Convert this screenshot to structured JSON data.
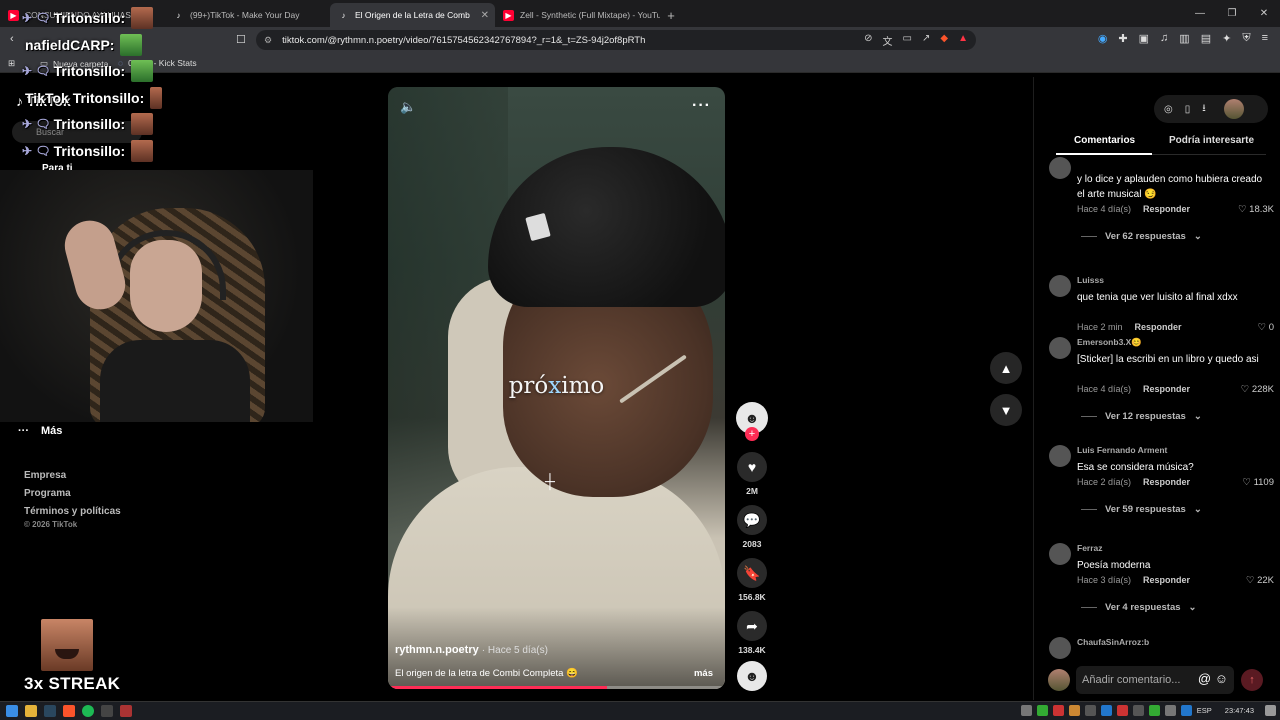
{
  "browser": {
    "tabs": [
      {
        "title": "CONSUMIENDO AYAHUASCA",
        "favicon": "youtube-icon",
        "color": "#ff0033"
      },
      {
        "title": "(99+)TikTok - Make Your Day",
        "favicon": "tiktok-icon",
        "color": "#ffffff"
      },
      {
        "title": "El Origen de la Letra de Comb",
        "favicon": "tiktok-icon",
        "color": "#ffffff"
      },
      {
        "title": "Zell - Synthetic (Full Mixtape) - YouTu",
        "favicon": "youtube-icon",
        "color": "#ff0033"
      }
    ],
    "url": "tiktok.com/@rythmn.n.poetry/video/7615754562342767894?_r=1&_t=ZS-94j2of8pRTh",
    "bookmarks": [
      {
        "label": "Nueva carpeta",
        "icon": "folder-icon"
      },
      {
        "label": "0Laco - Kick Stats",
        "icon": "kick-icon"
      }
    ]
  },
  "overlay": {
    "chat": [
      {
        "prefix": "✈ 🗨",
        "name": "Tritonsillo:",
        "emote": "face"
      },
      {
        "prefix": "",
        "name": "nafieldCARP:",
        "emote": "green"
      },
      {
        "prefix": "✈ 🗨",
        "name": "Tritonsillo:",
        "emote": "green"
      },
      {
        "prefix": "",
        "name": "TikTok Tritonsillo:",
        "emote": "face"
      },
      {
        "prefix": "✈ 🗨",
        "name": "Tritonsillo:",
        "emote": "face"
      },
      {
        "prefix": "✈ 🗨",
        "name": "Tritonsillo:",
        "emote": "face"
      }
    ],
    "streak": "3x STREAK"
  },
  "sidebar": {
    "logo": "TikTok",
    "search_placeholder": "Buscar",
    "for_you": "Para ti",
    "more": "Más",
    "links": [
      "Empresa",
      "Programa",
      "Términos y políticas"
    ],
    "copyright": "© 2026 TikTok"
  },
  "video": {
    "caption_pre": "pró",
    "caption_x": "x",
    "caption_post": "imo",
    "author": "rythmn.n.poetry",
    "posted": "· Hace 5 día(s)",
    "description": "El origen de la letra de Combi Completa 😄",
    "more_label": "más",
    "progress": 0.65,
    "accent": "#fe2c55"
  },
  "actions": {
    "likes": "2M",
    "comments": "2083",
    "saves": "156.8K",
    "shares": "138.4K"
  },
  "panel": {
    "tabs": [
      "Comentarios",
      "Podría interesarte"
    ],
    "comments": [
      {
        "user": "",
        "text": "y lo dice y aplauden como hubiera creado el arte musical 😏",
        "time": "Hace 4 día(s)",
        "likes": "18.3K",
        "replies": "Ver 62 respuestas"
      },
      {
        "user": "Luisss",
        "text": "que tenia que ver luisito al final xdxx",
        "time": "Hace 2 min",
        "likes": "0",
        "replies": ""
      },
      {
        "user": "Emersonb3.X😊",
        "text": "[Sticker] la escribi en un libro y quedo asi",
        "time": "Hace 4 día(s)",
        "likes": "228K",
        "replies": "Ver 12 respuestas"
      },
      {
        "user": "Luis Fernando Arment",
        "text": "Esa se considera música?",
        "time": "Hace 2 día(s)",
        "likes": "1109",
        "replies": "Ver 59 respuestas"
      },
      {
        "user": "Ferraz",
        "text": "Poesía moderna",
        "time": "Hace 3 día(s)",
        "likes": "22K",
        "replies": "Ver 4 respuestas"
      },
      {
        "user": "ChaufaSinArroz:b",
        "text": "",
        "time": "",
        "likes": "",
        "replies": ""
      }
    ],
    "reply_label": "Responder",
    "add_comment_placeholder": "Añadir comentario..."
  },
  "taskbar": {
    "lang": "ESP",
    "time": "23:47:43"
  }
}
